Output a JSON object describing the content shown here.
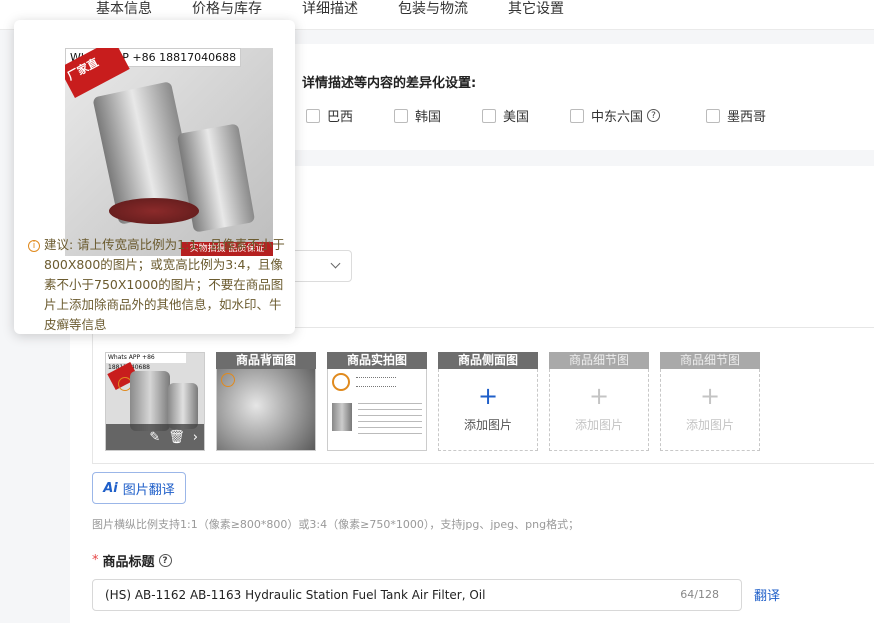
{
  "tabs": [
    "基本信息",
    "价格与库存",
    "详细描述",
    "包装与物流",
    "其它设置"
  ],
  "differentiation": {
    "title": "详情描述等内容的差异化设置:",
    "countries": [
      "巴西",
      "韩国",
      "美国",
      "中东六国",
      "墨西哥"
    ]
  },
  "popover": {
    "watermark": "Whats APP +86 18817040688",
    "factory_tag": "厂家直",
    "bottom_banner": "实物拍摄 品质保证",
    "advice": "建议: 请上传宽高比例为1:1，且像素不小于800X800的图片；或宽高比例为3:4，且像素不小于750X1000的图片；不要在商品图片上添加除商品外的其他信息，如水印、牛皮癣等信息"
  },
  "image_slots": [
    {
      "label": "",
      "state": "filled",
      "thumb_text": "Whats APP +86 18817040688"
    },
    {
      "label": "商品背面图",
      "state": "filled"
    },
    {
      "label": "商品实拍图",
      "state": "filled"
    },
    {
      "label": "商品侧面图",
      "state": "empty",
      "add_text": "添加图片",
      "active": true
    },
    {
      "label": "商品细节图",
      "state": "empty",
      "add_text": "添加图片",
      "active": false
    },
    {
      "label": "商品细节图",
      "state": "empty",
      "add_text": "添加图片",
      "active": false
    }
  ],
  "ai_translate_button": {
    "icon_text": "Ai",
    "label": "图片翻译"
  },
  "image_hint": "图片横纵比例支持1:1（像素≥800*800）或3:4（像素≥750*1000），支持jpg、jpeg、png格式；",
  "product_title": {
    "required_mark": "*",
    "label": "商品标题",
    "value": "(HS) AB-1162 AB-1163 Hydraulic Station Fuel Tank Air Filter, Oil",
    "counter": "64/128",
    "translate_link": "翻译"
  },
  "colors": {
    "accent": "#1f5fc9",
    "required": "#e64545",
    "warning": "#e08a1e"
  }
}
